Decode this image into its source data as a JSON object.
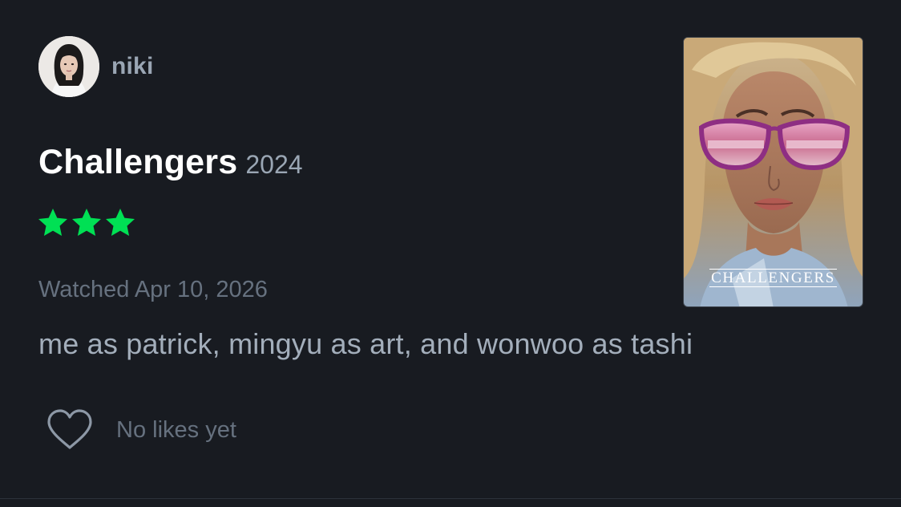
{
  "user": {
    "name": "niki",
    "avatar_icon": "avatar-photo"
  },
  "film": {
    "title": "Challengers",
    "year": "2024",
    "rating_stars": 3,
    "rating_max": 5,
    "poster_title": "CHALLENGERS"
  },
  "review": {
    "watched": "Watched Apr 10, 2026",
    "text": "me as patrick, mingyu as art, and wonwoo as tashi"
  },
  "likes": {
    "label": "No likes yet",
    "icon": "heart-icon"
  },
  "colors": {
    "background": "#181b21",
    "star": "#00e054",
    "muted_text": "#66717f",
    "secondary_text": "#9aa6b4"
  }
}
